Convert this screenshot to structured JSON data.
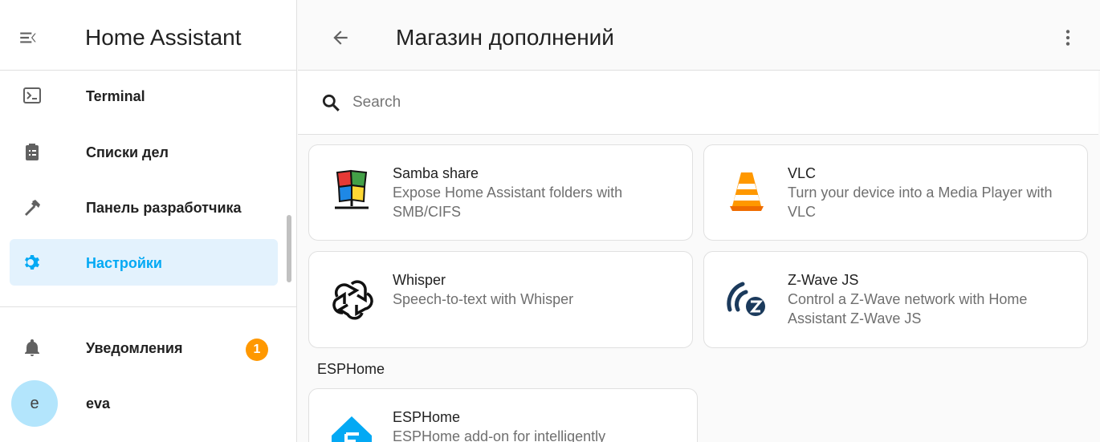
{
  "sidebar": {
    "title": "Home Assistant",
    "items": [
      {
        "label": "Terminal",
        "icon": "terminal-icon"
      },
      {
        "label": "Списки дел",
        "icon": "clipboard-list-icon"
      },
      {
        "label": "Панель разработчика",
        "icon": "hammer-icon"
      },
      {
        "label": "Настройки",
        "icon": "gear-icon",
        "active": true
      }
    ],
    "notifications": {
      "label": "Уведомления",
      "count": "1"
    },
    "user": {
      "initial": "e",
      "name": "eva"
    }
  },
  "header": {
    "title": "Магазин дополнений"
  },
  "search": {
    "placeholder": "Search"
  },
  "addons": [
    {
      "name": "Samba share",
      "description": "Expose Home Assistant folders with SMB/CIFS",
      "icon": "windows-folder-icon"
    },
    {
      "name": "VLC",
      "description": "Turn your device into a Media Player with VLC",
      "icon": "vlc-cone-icon"
    },
    {
      "name": "Whisper",
      "description": "Speech-to-text with Whisper",
      "icon": "openai-icon"
    },
    {
      "name": "Z-Wave JS",
      "description": "Control a Z-Wave network with Home Assistant Z-Wave JS",
      "icon": "zwave-icon"
    }
  ],
  "esphome_section": {
    "title": "ESPHome",
    "addons": [
      {
        "name": "ESPHome",
        "description": "ESPHome add-on for intelligently",
        "icon": "esphome-icon"
      }
    ]
  },
  "colors": {
    "accent": "#03a9f4",
    "active_bg": "#e3f2fd",
    "badge": "#ff9800",
    "avatar": "#b3e5fc"
  }
}
